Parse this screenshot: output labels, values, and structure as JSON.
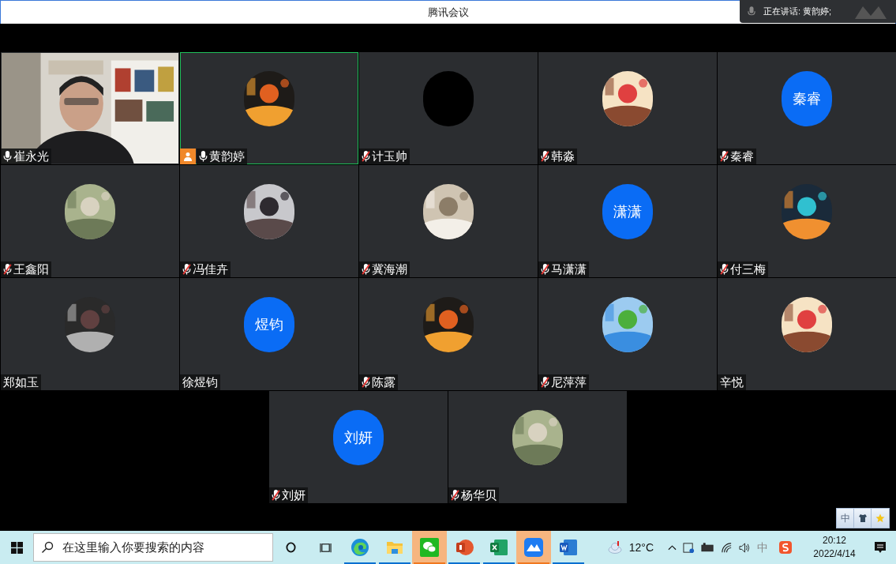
{
  "window": {
    "title": "腾讯会议"
  },
  "speaking": {
    "label": "正在讲话: 黄韵婷;"
  },
  "rows": [
    [
      {
        "name": "崔永光",
        "mic": {
          "muted": false
        },
        "avatar": {
          "kind": "video"
        },
        "speaking": false,
        "host": false
      },
      {
        "name": "黄韵婷",
        "mic": {
          "muted": false
        },
        "speaking": true,
        "host": true
      },
      {
        "name": "计玉帅",
        "mic": {
          "muted": true
        },
        "avatar": {
          "kind": "blank"
        },
        "speaking": false,
        "host": false
      },
      {
        "name": "韩淼",
        "mic": {
          "muted": true
        },
        "speaking": false,
        "host": false
      },
      {
        "name": "秦睿",
        "mic": {
          "muted": true
        },
        "avatar": {
          "kind": "initials",
          "initials": "秦睿"
        },
        "speaking": false,
        "host": false
      }
    ],
    [
      {
        "name": "王鑫阳",
        "mic": {
          "muted": true
        },
        "speaking": false,
        "host": false
      },
      {
        "name": "冯佳卉",
        "mic": {
          "muted": true
        },
        "speaking": false,
        "host": false
      },
      {
        "name": "冀海潮",
        "mic": {
          "muted": true
        },
        "speaking": false,
        "host": false
      },
      {
        "name": "马潇潇",
        "mic": {
          "muted": true
        },
        "avatar": {
          "kind": "initials",
          "initials": "潇潇"
        },
        "speaking": false,
        "host": false
      },
      {
        "name": "付三梅",
        "mic": {
          "muted": true
        },
        "speaking": false,
        "host": false
      }
    ],
    [
      {
        "name": "郑如玉",
        "speaking": false,
        "host": false
      },
      {
        "name": "徐煜钧",
        "avatar": {
          "kind": "initials",
          "initials": "煜钧"
        },
        "speaking": false,
        "host": false
      },
      {
        "name": "陈露",
        "mic": {
          "muted": true
        },
        "speaking": false,
        "host": false
      },
      {
        "name": "尼萍萍",
        "mic": {
          "muted": true
        },
        "speaking": false,
        "host": false
      },
      {
        "name": "辛悦",
        "speaking": false,
        "host": false
      }
    ],
    [
      {
        "name": "刘妍",
        "mic": {
          "muted": true
        },
        "avatar": {
          "kind": "initials",
          "initials": "刘妍"
        },
        "speaking": false,
        "host": false
      },
      {
        "name": "杨华贝",
        "mic": {
          "muted": true
        },
        "speaking": false,
        "host": false
      }
    ]
  ],
  "ime_bar": {
    "mode": "中"
  },
  "taskbar": {
    "search": {
      "placeholder": "在这里输入你要搜索的内容"
    },
    "apps": [
      {
        "kind": "edge",
        "active": false
      },
      {
        "kind": "folder",
        "active": false
      },
      {
        "kind": "wechat",
        "active": true
      },
      {
        "kind": "powerpoint",
        "active": false
      },
      {
        "kind": "excel",
        "active": false
      },
      {
        "kind": "meeting",
        "active": true
      },
      {
        "kind": "word",
        "active": false
      }
    ],
    "weather": "12°C",
    "ime": "中",
    "time": "20:12",
    "date": "2022/4/14"
  }
}
